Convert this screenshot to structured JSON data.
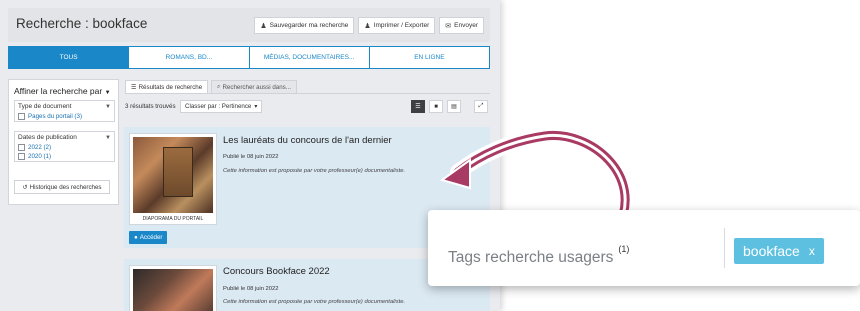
{
  "header": {
    "title": "Recherche : bookface",
    "actions": [
      {
        "icon": "user-save-icon",
        "label": "Sauvegarder ma recherche"
      },
      {
        "icon": "print-icon",
        "label": "Imprimer / Exporter"
      },
      {
        "icon": "envelope-icon",
        "label": "Envoyer"
      }
    ]
  },
  "tabs": [
    {
      "label": "TOUS",
      "active": true
    },
    {
      "label": "ROMANS, BD...",
      "active": false
    },
    {
      "label": "MÉDIAS, DOCUMENTAIRES...",
      "active": false
    },
    {
      "label": "EN LIGNE",
      "active": false
    }
  ],
  "sidebar": {
    "title": "Affiner la recherche par",
    "groups": [
      {
        "label": "Type de document",
        "items": [
          "Pages du portail (3)"
        ]
      },
      {
        "label": "Dates de publication",
        "items": [
          "2022 (2)",
          "2020 (1)"
        ]
      }
    ],
    "history_label": "Historique des recherches"
  },
  "result_tabs": [
    "Résultats de recherche",
    "Rechercher aussi dans..."
  ],
  "toolbar": {
    "count": "3 résultats trouvés",
    "sort_label": "Classer par : Pertinence"
  },
  "results": [
    {
      "title": "Les lauréats du concours de l'an dernier",
      "date": "Publié le 08 juin 2022",
      "description": "Cette information est proposée par votre professeur(e) documentaliste.",
      "thumb_caption": "DIAPORAMA DU PORTAIL",
      "action": "Accéder"
    },
    {
      "title": "Concours Bookface 2022",
      "date": "Publié le 08 juin 2022",
      "description": "Cette information est proposée par votre professeur(e) documentaliste."
    }
  ],
  "callout": {
    "label": "Tags recherche usagers",
    "count": "(1)",
    "tag": "bookface",
    "tag_remove": "x"
  },
  "colors": {
    "accent": "#1a87c8",
    "result_bg": "#dbe9f3",
    "tag_bg": "#5ec0e0",
    "arrow": "#a83a63"
  }
}
